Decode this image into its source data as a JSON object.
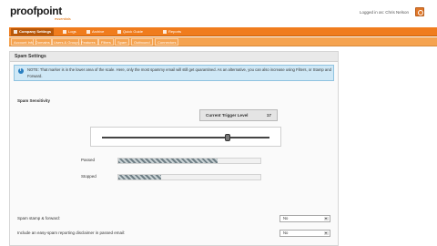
{
  "header": {
    "logo": "proofpoint",
    "logo_sub": "essentials",
    "logged_in": "Logged in as: Chris Nelson"
  },
  "nav": {
    "items": [
      {
        "label": "Company Settings",
        "active": true
      },
      {
        "label": "Logs"
      },
      {
        "label": "Archive"
      },
      {
        "label": "Quick Guide"
      },
      {
        "label": "Reports"
      }
    ]
  },
  "subnav": {
    "items": [
      "Account Info",
      "Domains",
      "Users & Groups",
      "Features",
      "Filters",
      "Spam",
      "Outbound",
      "Connectors"
    ]
  },
  "panel": {
    "title": "Spam Settings",
    "note": "NOTE: That marker is in the lower area of the scale. Here, only the most spammy email will still get quarantined. As an alternative, you can also increase using Filters, or Stamp and Forward.",
    "sensitivity_label": "Spam Sensitivity",
    "trigger_label": "Current Trigger Level",
    "trigger_value": "17",
    "slider_value": 0.75,
    "passed_label": "Passed",
    "passed_fraction": 0.7,
    "stopped_label": "Stopped",
    "stopped_fraction": 0.3,
    "stamp_label": "Spam stamp & forward:",
    "stamp_value": "No",
    "disclaimer_label": "Include an easy-spam reporting disclaimer in passed email:",
    "disclaimer_value": "No"
  },
  "colors": {
    "nav_bg": "#f07c1d",
    "subnav_bg": "#f5a350",
    "note_bg": "#cfe8f6"
  }
}
